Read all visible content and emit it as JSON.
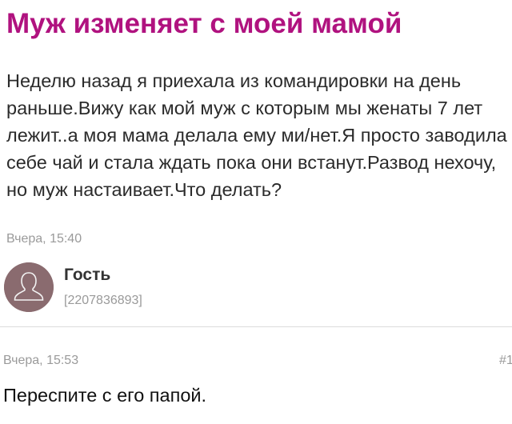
{
  "post": {
    "title": "Муж изменяет с моей мамой",
    "body": "Неделю назад я приехала из командировки на день раньше.Вижу как мой муж с которым мы женаты 7 лет лежит..а моя мама делала ему ми/нет.Я просто заводила себе чай и стала ждать пока они встанут.Развод нехочу, но муж настаивает.Что делать?",
    "date": "Вчера, 15:40",
    "author": {
      "name": "Гость",
      "id": "[2207836893]",
      "avatar_icon": "user-silhouette-icon"
    }
  },
  "reply": {
    "date": "Вчера, 15:53",
    "number": "#1",
    "text": "Переспите с его папой."
  },
  "colors": {
    "title": "#b0127f",
    "body_text": "#2b2b2b",
    "muted": "#9a9a9a",
    "avatar_bg": "#8a6b6f",
    "divider": "#dcdcdc"
  }
}
